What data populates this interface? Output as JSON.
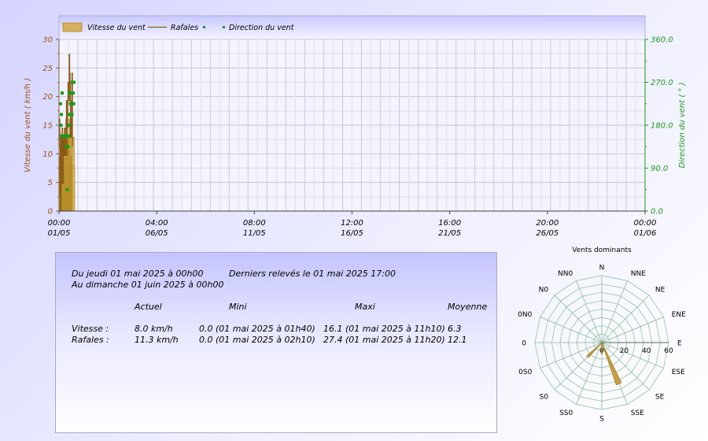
{
  "colors": {
    "speed_fill": "#d4b060",
    "speed_stroke": "#b08820",
    "gust_line": "#8a5a10",
    "direction": "#1a9a1a",
    "left_axis_text": "#a05010",
    "right_axis_text": "#1a9a1a",
    "rose_line": "#88bb99",
    "rose_petal": "#c8a040"
  },
  "legend": {
    "speed": "Vitesse du vent",
    "gust": "Rafales",
    "direction": "Direction du vent"
  },
  "chart_data": [
    {
      "type": "bar+line+scatter",
      "ylabel": "Vitesse du vent  ( km/h )",
      "ylabel_right": "Direction du vent  ( ° )",
      "ylim": [
        0,
        30
      ],
      "ylim_right": [
        0,
        360
      ],
      "yticks": [
        0,
        5,
        10,
        15,
        20,
        25,
        30
      ],
      "yticks_right": [
        "0.0",
        "90.0",
        "180.0",
        "270.0",
        "360.0"
      ],
      "xlim_hours": [
        0,
        744
      ],
      "xticks": [
        {
          "time": "00:00",
          "date": "01/05",
          "hour": 0
        },
        {
          "time": "04:00",
          "date": "06/05",
          "hour": 124
        },
        {
          "time": "08:00",
          "date": "11/05",
          "hour": 248
        },
        {
          "time": "12:00",
          "date": "16/05",
          "hour": 372
        },
        {
          "time": "16:00",
          "date": "21/05",
          "hour": 496
        },
        {
          "time": "20:00",
          "date": "26/05",
          "hour": 620
        },
        {
          "time": "00:00",
          "date": "01/06",
          "hour": 744
        }
      ],
      "legend_position": "top-left",
      "grid": true,
      "series": [
        {
          "name": "Vitesse du vent",
          "kind": "bar",
          "x_hours": [
            0,
            0.5,
            1,
            1.5,
            2,
            2.5,
            3,
            3.5,
            4,
            4.5,
            5,
            5.5,
            6,
            6.5,
            7,
            7.5,
            8,
            8.5,
            9,
            9.5,
            10,
            10.5,
            11,
            11.5,
            12,
            12.5,
            13,
            13.5,
            14,
            14.5,
            15,
            15.5,
            16,
            16.5,
            17
          ],
          "values": [
            8,
            9.5,
            9.5,
            0,
            9.5,
            3,
            9.5,
            9.5,
            6.4,
            9.5,
            3,
            8,
            9.5,
            6.4,
            9.5,
            9.5,
            8,
            9.5,
            9.5,
            12.9,
            3,
            9.5,
            12.9,
            8,
            12.9,
            12.9,
            16.1,
            16.1,
            12.9,
            8,
            9.5,
            9.5,
            12.9,
            12.9,
            8
          ]
        },
        {
          "name": "Rafales",
          "kind": "line",
          "x_hours": [
            0,
            0.5,
            1,
            1.5,
            2,
            2.5,
            3,
            3.5,
            4,
            4.5,
            5,
            5.5,
            6,
            6.5,
            7,
            7.5,
            8,
            8.5,
            9,
            9.5,
            10,
            10.5,
            11,
            11.5,
            12,
            12.5,
            13,
            13.5,
            14,
            14.5,
            15,
            15.5,
            16,
            16.5,
            17
          ],
          "values": [
            12.9,
            16.1,
            11.3,
            3,
            0,
            12.9,
            4.8,
            11.3,
            14.5,
            9.7,
            4.8,
            12.9,
            11.3,
            9.7,
            14.5,
            12.9,
            9.7,
            12.9,
            16.1,
            19.3,
            9.7,
            14.5,
            19.3,
            22.5,
            21,
            19.3,
            27.4,
            24.1,
            22.5,
            12.9,
            12.9,
            16.1,
            19.3,
            24.1,
            11.3
          ]
        },
        {
          "name": "Direction du vent",
          "kind": "scatter",
          "x_hours": [
            0,
            0.5,
            1,
            1.5,
            2,
            2.5,
            3,
            3.5,
            4,
            4.5,
            5,
            5.5,
            6,
            6.5,
            7,
            7.5,
            8,
            8.5,
            9,
            9.5,
            10,
            10.5,
            11,
            11.5,
            12,
            12.5,
            13,
            13.5,
            14,
            14.5,
            15,
            15.5,
            16,
            16.5,
            17
          ],
          "values": [
            225,
            180,
            202.5,
            157.5,
            247.5,
            157.5,
            157.5,
            157.5,
            157.5,
            157.5,
            157.5,
            157.5,
            157.5,
            157.5,
            157.5,
            135,
            157.5,
            45,
            157.5,
            135,
            157.5,
            180,
            247.5,
            202.5,
            202.5,
            225,
            202.5,
            247.5,
            202.5,
            202.5,
            270,
            225,
            247.5,
            225,
            270
          ]
        }
      ]
    },
    {
      "type": "polar-bar",
      "title": "Vents dominants",
      "directions": [
        "N",
        "NNE",
        "NE",
        "ENE",
        "E",
        "ESE",
        "SE",
        "SSE",
        "S",
        "SS0",
        "S0",
        "0S0",
        "0",
        "0N0",
        "N0",
        "NN0"
      ],
      "radial_ticks": [
        0,
        20,
        40,
        60
      ],
      "rmax": 60,
      "values": [
        0,
        0,
        0,
        0,
        0,
        0,
        0,
        40,
        10,
        0,
        18,
        0,
        0,
        0,
        0,
        0
      ]
    }
  ],
  "info": {
    "period_start": "Du jeudi 01 mai 2025 à 00h00",
    "period_end": "Au dimanche 01 juin 2025 à 00h00",
    "last_reading": "Derniers relevés le 01 mai 2025 17:00",
    "headers": {
      "current": "Actuel",
      "min": "Mini",
      "max": "Maxi",
      "avg": "Moyenne"
    },
    "rows": [
      {
        "label": "Vitesse :",
        "current": "8.0 km/h",
        "min": "0.0 (01 mai 2025 à 01h40)",
        "max": "16.1 (01 mai 2025 à 11h10)",
        "avg": "6.3"
      },
      {
        "label": "Rafales :",
        "current": "11.3 km/h",
        "min": "0.0 (01 mai 2025 à 02h10)",
        "max": "27.4 (01 mai 2025 à 11h20)",
        "avg": "12.1"
      }
    ]
  }
}
